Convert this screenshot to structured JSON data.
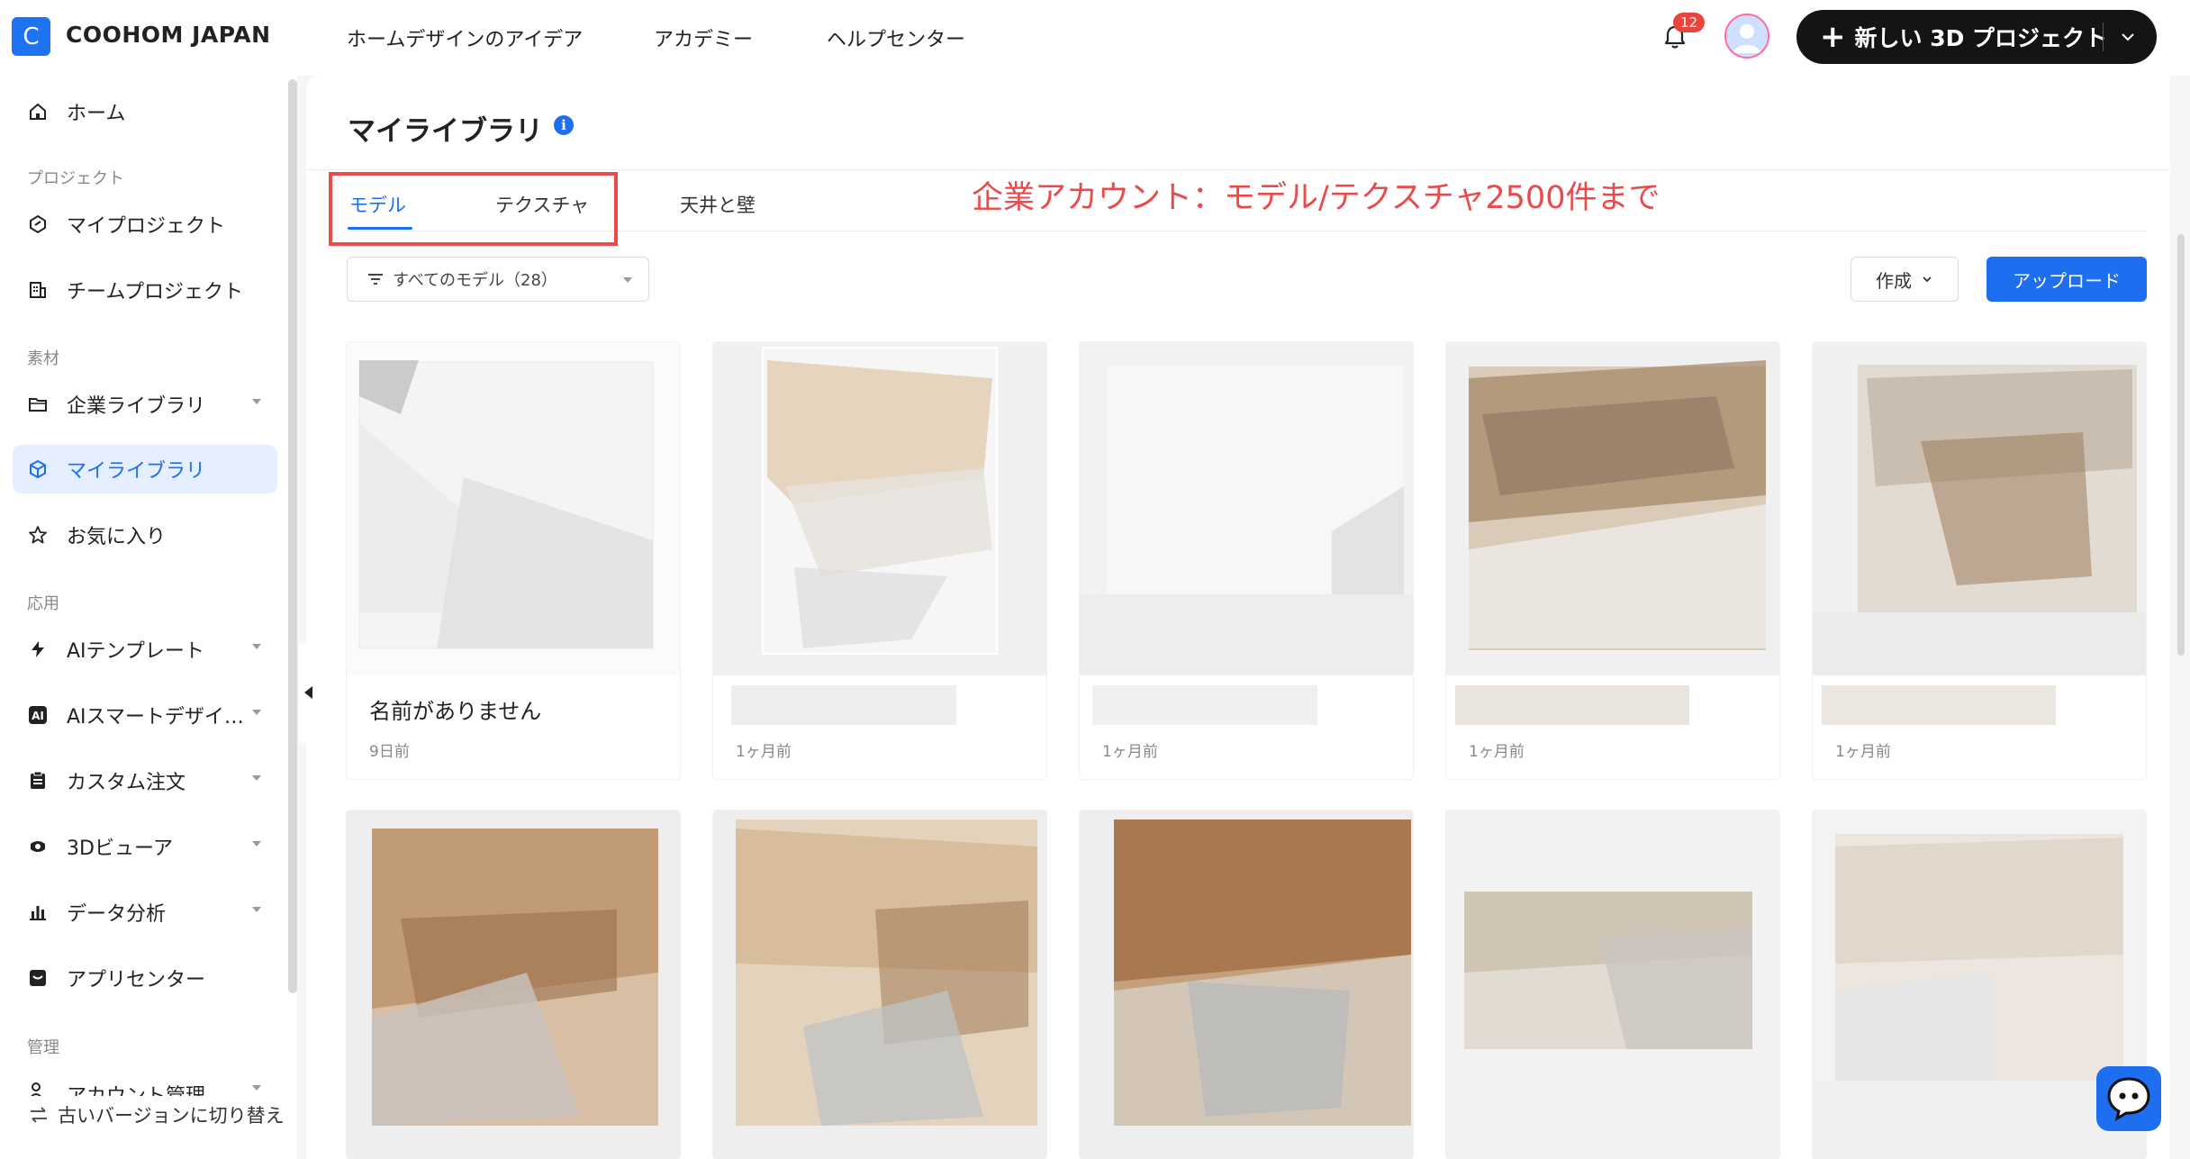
{
  "brand": {
    "logo_letter": "C",
    "name": "COOHOM JAPAN"
  },
  "topnav": {
    "items": [
      "ホームデザインのアイデア",
      "アカデミー",
      "ヘルプセンター"
    ],
    "notification_count": "12",
    "new_project_label": "新しい 3D プロジェクト"
  },
  "sidebar": {
    "home": "ホーム",
    "section_project": "プロジェクト",
    "my_projects": "マイプロジェクト",
    "team_projects": "チームプロジェクト",
    "section_material": "素材",
    "enterprise_library": "企業ライブラリ",
    "my_library": "マイライブラリ",
    "favorites": "お気に入り",
    "section_apps": "応用",
    "ai_templates": "AIテンプレート",
    "ai_smart_design": "AIスマートデザイ…",
    "custom_order": "カスタム注文",
    "viewer_3d": "3Dビューア",
    "data_analysis": "データ分析",
    "app_center": "アプリセンター",
    "section_admin": "管理",
    "account_mgmt": "アカウント管理",
    "old_version": "古いバージョンに切り替え"
  },
  "main": {
    "title": "マイライブラリ",
    "info_glyph": "i",
    "tabs": [
      "モデル",
      "テクスチャ",
      "天井と壁"
    ],
    "annotation": "企業アカウント：モデル/テクスチャ2500件まで",
    "filter_label": "すべてのモデル（28）",
    "create_label": "作成",
    "upload_label": "アップロード"
  },
  "cards": [
    {
      "name": "名前がありません",
      "date": "9日前"
    },
    {
      "name": "",
      "date": "1ヶ月前"
    },
    {
      "name": "",
      "date": "1ヶ月前"
    },
    {
      "name": "",
      "date": "1ヶ月前"
    },
    {
      "name": "",
      "date": "1ヶ月前"
    },
    {
      "name": "",
      "date": ""
    },
    {
      "name": "",
      "date": ""
    },
    {
      "name": "",
      "date": ""
    },
    {
      "name": "",
      "date": ""
    },
    {
      "name": "",
      "date": ""
    }
  ],
  "colors": {
    "accent": "#1e6ff0",
    "annotation_red": "#ea4a4a",
    "dark_button": "#141414"
  }
}
